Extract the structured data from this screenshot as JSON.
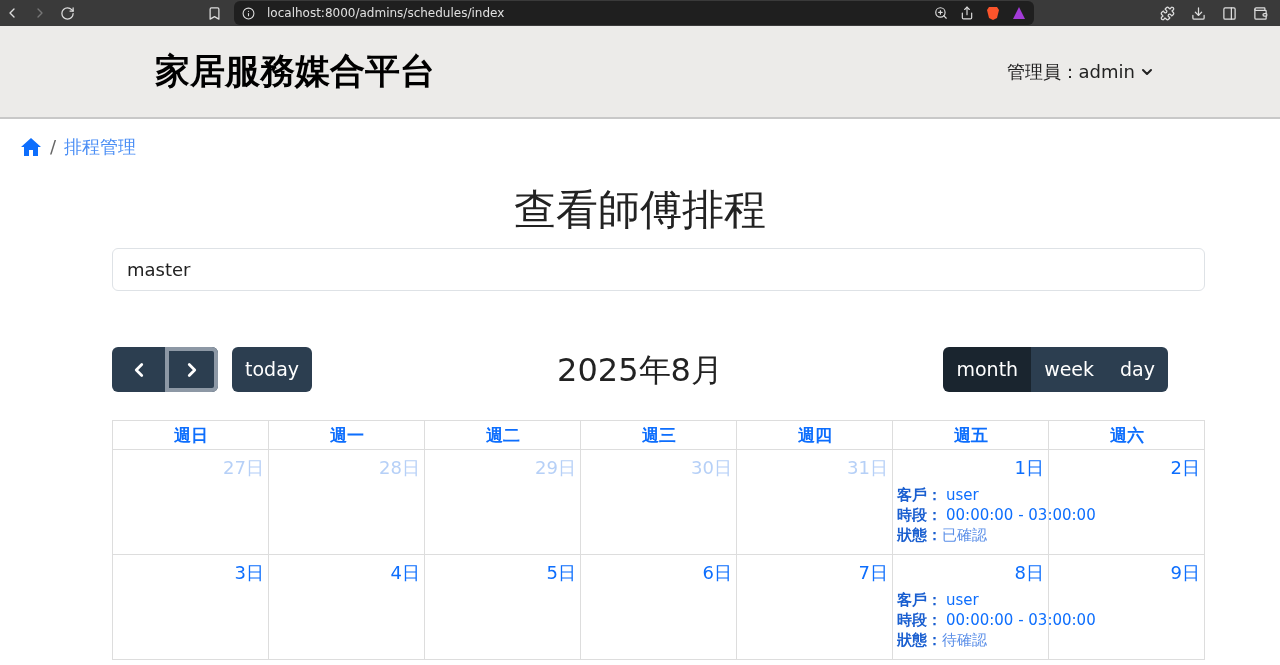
{
  "browser": {
    "url": "localhost:8000/admins/schedules/index"
  },
  "header": {
    "brand": "家居服務媒合平台",
    "user_menu": "管理員：admin"
  },
  "breadcrumb": {
    "separator": "/",
    "items": [
      "排程管理"
    ]
  },
  "page_title": "查看師傅排程",
  "master_field": {
    "value": "master"
  },
  "calendar": {
    "title": "2025年8月",
    "today_button": "today",
    "nav": [
      {
        "kind": "prev",
        "focused": false
      },
      {
        "kind": "next",
        "focused": true
      }
    ],
    "views": [
      {
        "label": "month",
        "selected": true
      },
      {
        "label": "week",
        "selected": false
      },
      {
        "label": "day",
        "selected": false
      }
    ],
    "weekdays": [
      "週日",
      "週一",
      "週二",
      "週三",
      "週四",
      "週五",
      "週六"
    ],
    "weeks": [
      {
        "days": [
          {
            "label": "27日",
            "other_month": true
          },
          {
            "label": "28日",
            "other_month": true
          },
          {
            "label": "29日",
            "other_month": true
          },
          {
            "label": "30日",
            "other_month": true
          },
          {
            "label": "31日",
            "other_month": true
          },
          {
            "label": "1日",
            "other_month": false,
            "events": [
              {
                "customer_label": "客戶：",
                "customer": "user",
                "time_label": "時段：",
                "time": "00:00:00 - 03:00:00",
                "status_label": "狀態：",
                "status": "已確認"
              }
            ]
          },
          {
            "label": "2日",
            "other_month": false
          }
        ]
      },
      {
        "days": [
          {
            "label": "3日",
            "other_month": false
          },
          {
            "label": "4日",
            "other_month": false
          },
          {
            "label": "5日",
            "other_month": false
          },
          {
            "label": "6日",
            "other_month": false
          },
          {
            "label": "7日",
            "other_month": false
          },
          {
            "label": "8日",
            "other_month": false,
            "events": [
              {
                "customer_label": "客戶：",
                "customer": "user",
                "time_label": "時段：",
                "time": "00:00:00 - 03:00:00",
                "status_label": "狀態：",
                "status": "待確認"
              }
            ]
          },
          {
            "label": "9日",
            "other_month": false
          }
        ]
      }
    ]
  }
}
